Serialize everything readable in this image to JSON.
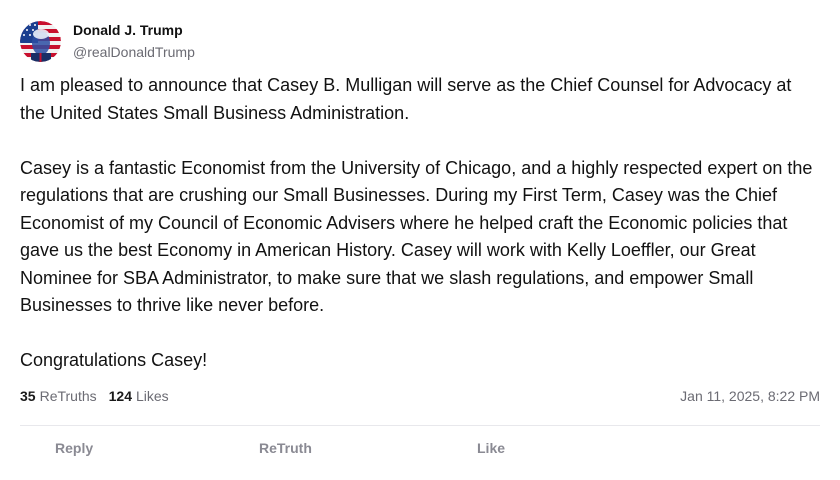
{
  "author": {
    "display_name": "Donald J. Trump",
    "handle": "@realDonaldTrump",
    "avatar_icon": "profile-avatar"
  },
  "post": {
    "paragraphs": [
      "I am pleased to announce that Casey B. Mulligan will serve as the Chief Counsel for Advocacy at the United States Small Business Administration.",
      "Casey is a fantastic Economist from the University of Chicago, and a highly respected expert on the regulations that are crushing our Small Businesses. During my First Term, Casey was the Chief Economist of my Council of Economic Advisers where he helped craft the Economic policies that gave us the best Economy in American History. Casey will work with Kelly Loeffler, our Great Nominee for SBA Administrator, to make sure that we slash regulations, and empower Small Businesses to thrive like never before.",
      "Congratulations Casey!"
    ]
  },
  "stats": {
    "retruths_count": "35",
    "retruths_label": "ReTruths",
    "likes_count": "124",
    "likes_label": "Likes",
    "timestamp": "Jan 11, 2025, 8:22 PM"
  },
  "actions": {
    "reply_label": "Reply",
    "retruth_label": "ReTruth",
    "like_label": "Like"
  },
  "colors": {
    "text": "#121212",
    "muted": "#6b6b73",
    "action": "#8a8a93",
    "divider": "#e8e8ec"
  }
}
